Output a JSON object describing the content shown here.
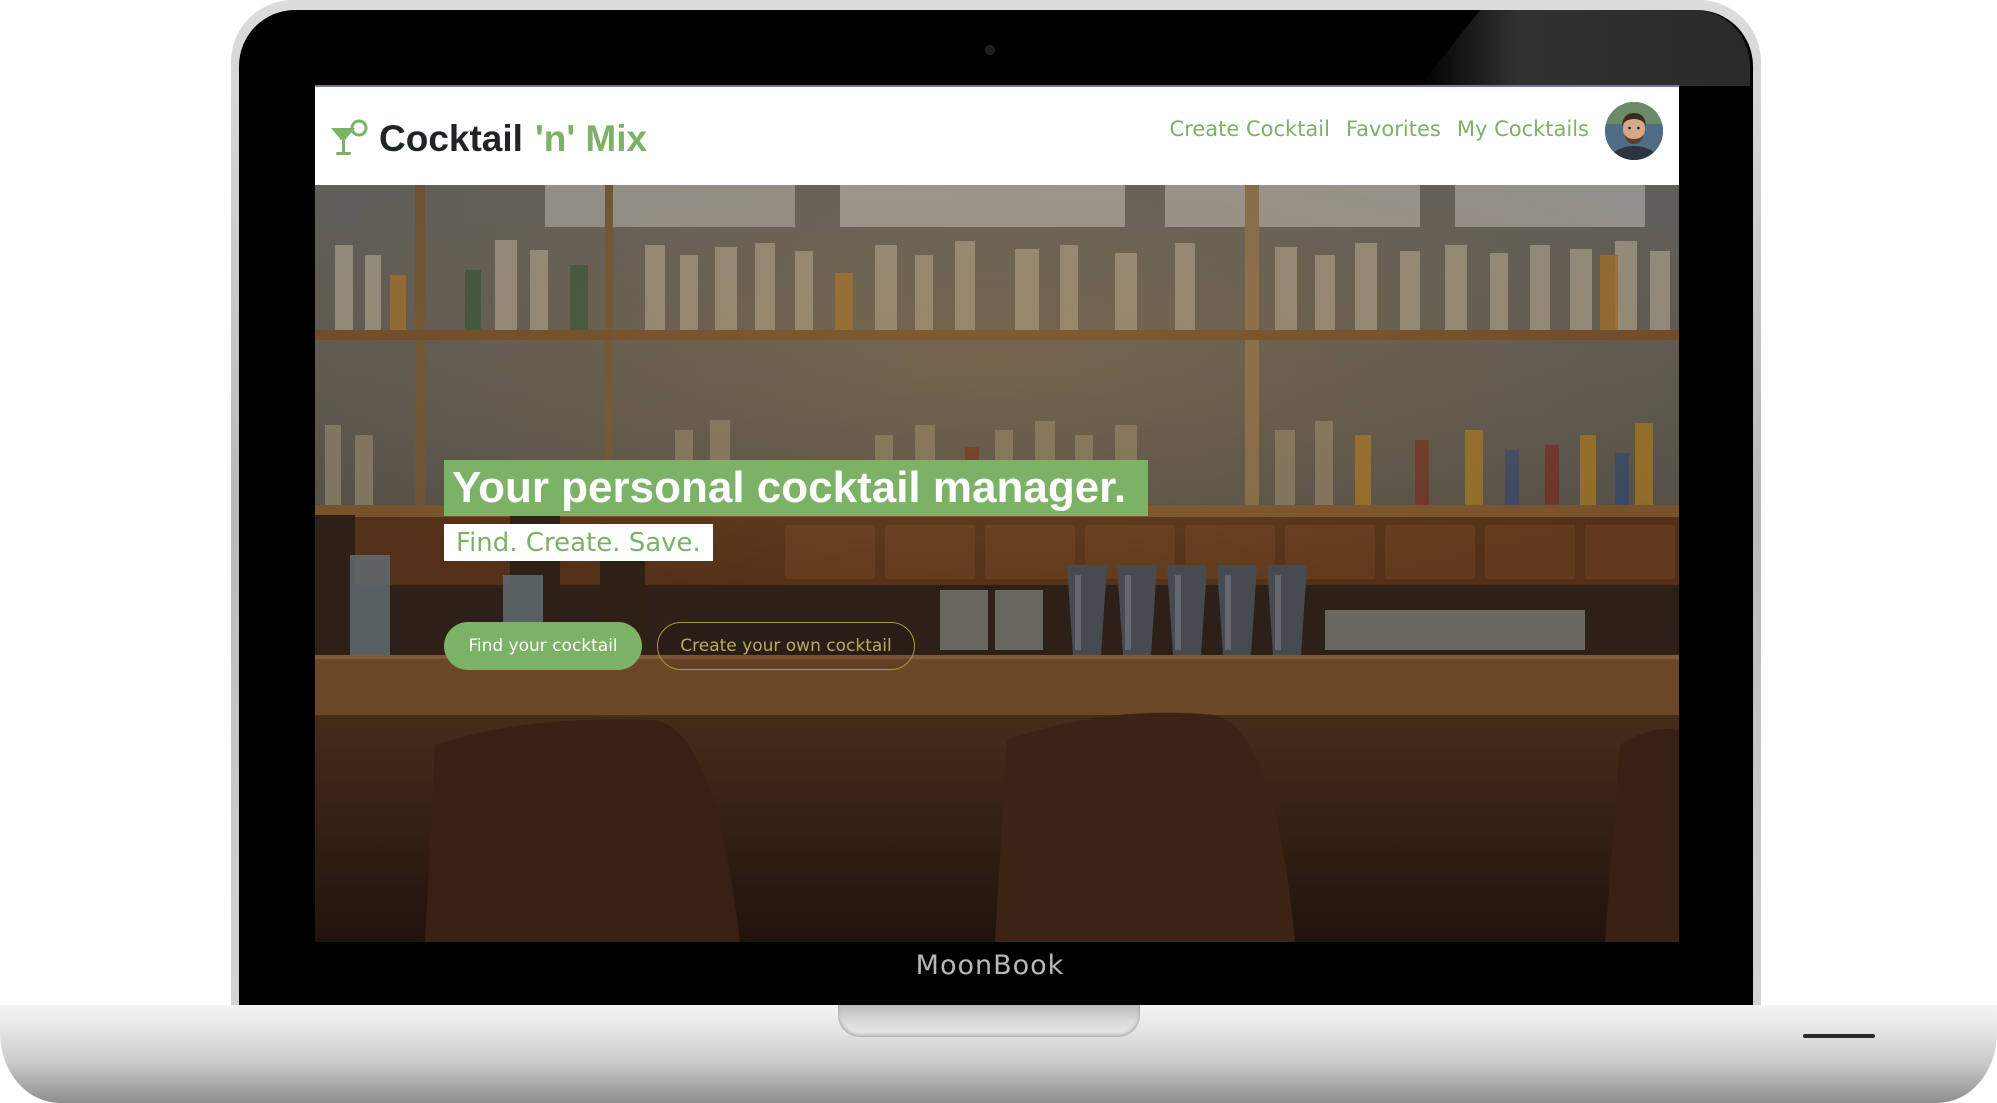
{
  "device": {
    "brand_label": "MoonBook"
  },
  "navbar": {
    "logo": {
      "name": "Cocktail",
      "accent": "'n' Mix",
      "icon": "cocktail-glass-icon"
    },
    "links": [
      {
        "label": "Create Cocktail"
      },
      {
        "label": "Favorites"
      },
      {
        "label": "My Cocktails"
      }
    ],
    "avatar_icon": "user-avatar"
  },
  "hero": {
    "title": "Your personal cocktail manager.",
    "subtitle": "Find. Create. Save.",
    "primary_button": "Find your cocktail",
    "secondary_button": "Create your own cocktail"
  },
  "colors": {
    "accent": "#7bb266",
    "dark_text": "#1f2526",
    "outline_button": "#a89a3a"
  }
}
